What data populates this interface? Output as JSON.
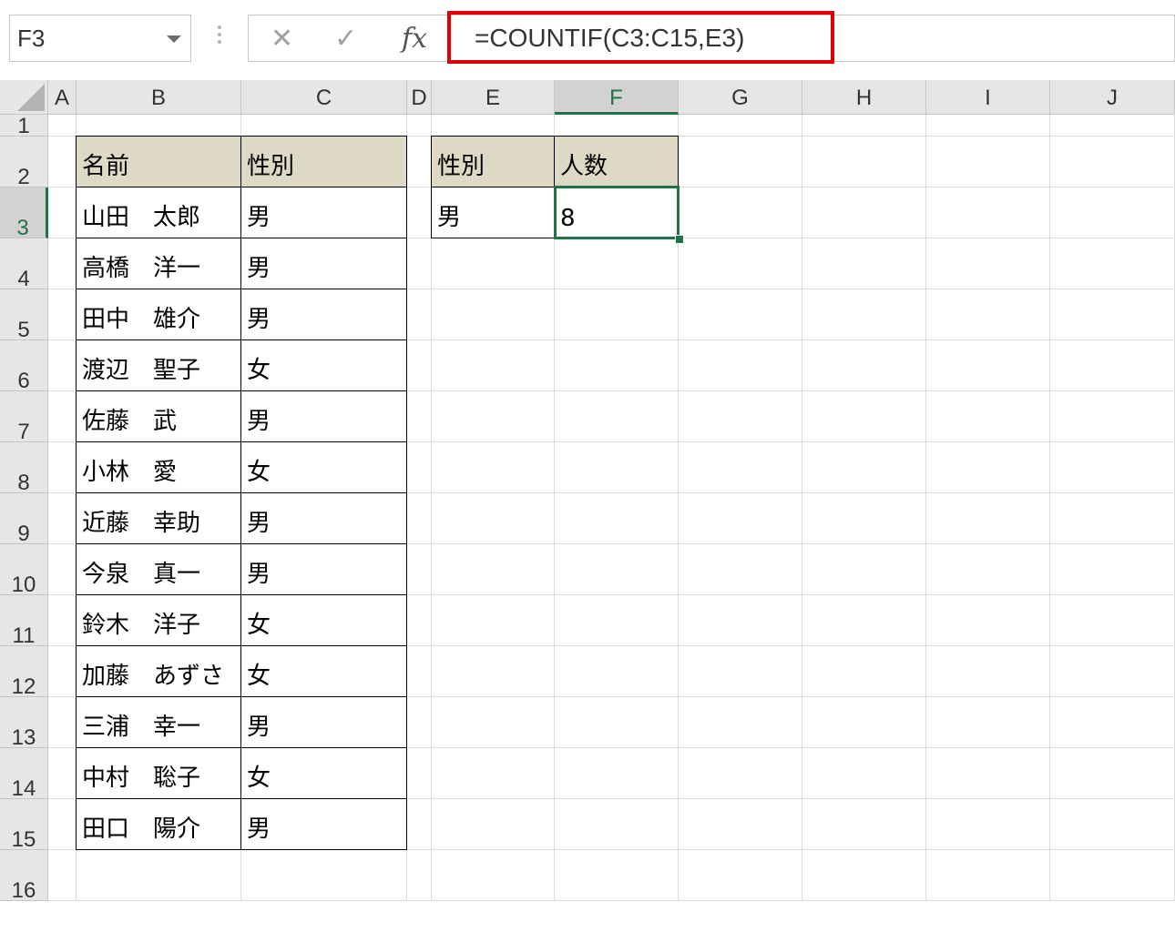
{
  "name_box": {
    "value": "F3"
  },
  "formula_bar": {
    "cancel_icon": "close-icon",
    "enter_icon": "check-icon",
    "fx_label": "fx",
    "formula": "=COUNTIF(C3:C15,E3)",
    "highlight_color": "#e00000"
  },
  "columns": [
    "A",
    "B",
    "C",
    "D",
    "E",
    "F",
    "G",
    "H",
    "I",
    "J"
  ],
  "rows": [
    "1",
    "2",
    "3",
    "4",
    "5",
    "6",
    "7",
    "8",
    "9",
    "10",
    "11",
    "12",
    "13",
    "14",
    "15",
    "16"
  ],
  "selected_cell": {
    "column": "F",
    "row": "3"
  },
  "accent_color": "#217346",
  "header_fill": "#ddd9c4",
  "table1": {
    "headers": [
      "名前",
      "性別"
    ],
    "rows": [
      [
        "山田　太郎",
        "男"
      ],
      [
        "高橋　洋一",
        "男"
      ],
      [
        "田中　雄介",
        "男"
      ],
      [
        "渡辺　聖子",
        "女"
      ],
      [
        "佐藤　武",
        "男"
      ],
      [
        "小林　愛",
        "女"
      ],
      [
        "近藤　幸助",
        "男"
      ],
      [
        "今泉　真一",
        "男"
      ],
      [
        "鈴木　洋子",
        "女"
      ],
      [
        "加藤　あずさ",
        "女"
      ],
      [
        "三浦　幸一",
        "男"
      ],
      [
        "中村　聡子",
        "女"
      ],
      [
        "田口　陽介",
        "男"
      ]
    ]
  },
  "table2": {
    "headers": [
      "性別",
      "人数"
    ],
    "row": [
      "男",
      "8"
    ]
  }
}
